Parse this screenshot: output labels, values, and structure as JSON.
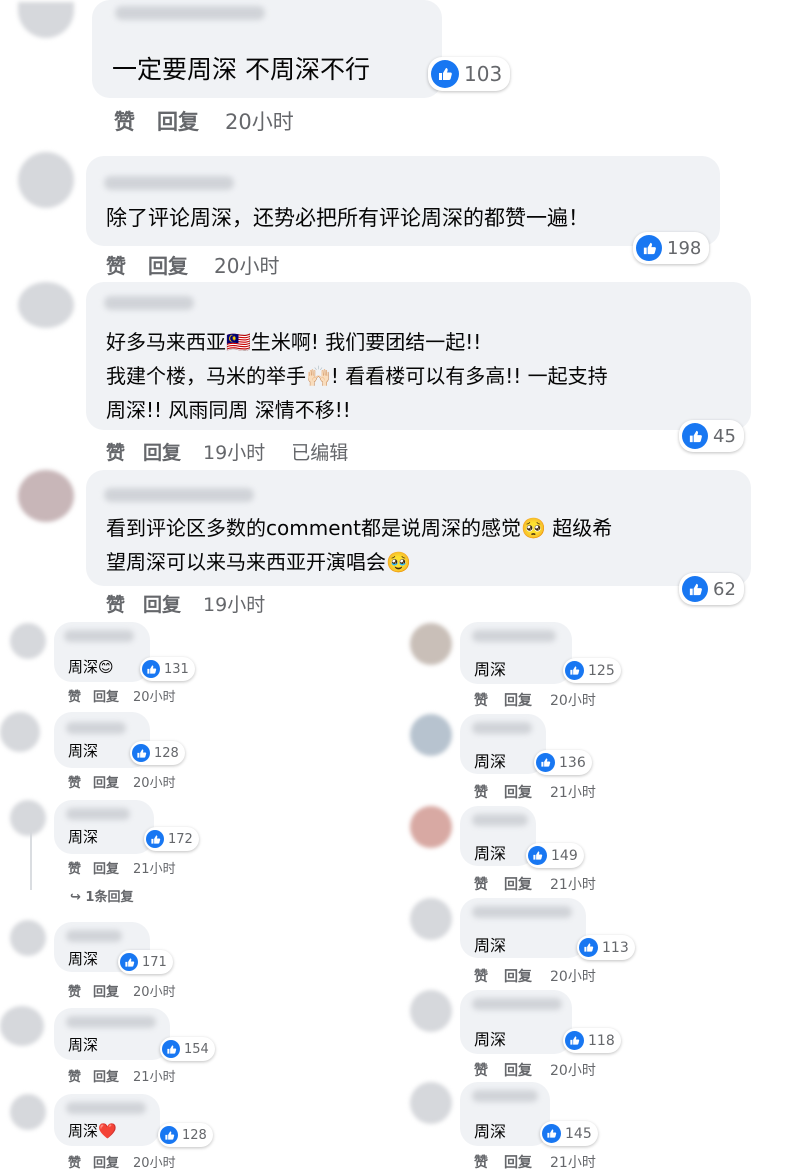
{
  "action_like": "赞",
  "action_reply": "回复",
  "like_icon": "thumbs-up-icon",
  "accent_color": "#1877f2",
  "comments": [
    {
      "text": "一定要周深 不周深不行",
      "reactions": "103",
      "time": "20小时"
    },
    {
      "text": "除了评论周深，还势必把所有评论周深的都赞一遍！",
      "reactions": "198",
      "time": "20小时"
    },
    {
      "lines": [
        "好多马来西亚🇲🇾生米啊! 我们要团结一起!!",
        "我建个楼，马米的举手🙌🏻! 看看楼可以有多高!! 一起支持",
        "周深!! 风雨同周 深情不移!!"
      ],
      "reactions": "45",
      "time": "19小时",
      "edited": "已编辑"
    },
    {
      "lines": [
        "看到评论区多数的comment都是说周深的感觉🥺 超级希",
        "望周深可以来马来西亚开演唱会🥹"
      ],
      "reactions": "62",
      "time": "19小时"
    }
  ],
  "left_comments": [
    {
      "text": "周深😊",
      "reactions": "131",
      "time": "20小时"
    },
    {
      "text": "周深",
      "reactions": "128",
      "time": "20小时"
    },
    {
      "text": "周深",
      "reactions": "172",
      "time": "21小时",
      "replies": "↪ 1条回复"
    },
    {
      "text": "周深",
      "reactions": "171",
      "time": "20小时"
    },
    {
      "text": "周深",
      "reactions": "154",
      "time": "21小时"
    },
    {
      "text": "周深❤️",
      "reactions": "128",
      "time": "20小时"
    }
  ],
  "right_comments": [
    {
      "text": "周深",
      "reactions": "125",
      "time": "20小时"
    },
    {
      "text": "周深",
      "reactions": "136",
      "time": "21小时"
    },
    {
      "text": "周深",
      "reactions": "149",
      "time": "21小时"
    },
    {
      "text": "周深",
      "reactions": "113",
      "time": "20小时"
    },
    {
      "text": "周深",
      "reactions": "118",
      "time": "20小时"
    },
    {
      "text": "周深",
      "reactions": "145",
      "time": "21小时"
    }
  ]
}
